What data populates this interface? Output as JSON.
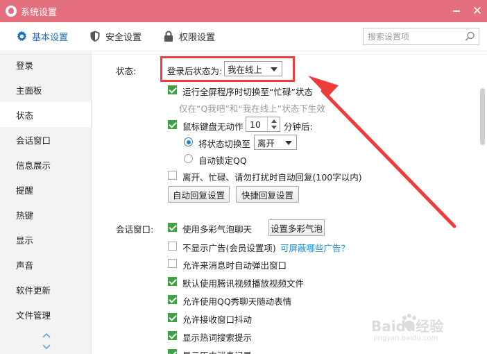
{
  "window": {
    "title": "系统设置"
  },
  "toolbar": {
    "tabs": [
      {
        "label": "基本设置",
        "icon": "gear-icon",
        "active": true
      },
      {
        "label": "安全设置",
        "icon": "shield-icon",
        "active": false
      },
      {
        "label": "权限设置",
        "icon": "lock-icon",
        "active": false
      }
    ],
    "search_placeholder": "搜索设置项"
  },
  "sidebar": {
    "items": [
      {
        "label": "登录"
      },
      {
        "label": "主面板"
      },
      {
        "label": "状态",
        "active": true
      },
      {
        "label": "会话窗口"
      },
      {
        "label": "信息展示"
      },
      {
        "label": "提醒"
      },
      {
        "label": "热键"
      },
      {
        "label": "显示"
      },
      {
        "label": "声音"
      },
      {
        "label": "软件更新"
      },
      {
        "label": "文件管理"
      }
    ]
  },
  "status_section": {
    "heading": "状态:",
    "login_status_label": "登录后状态为:",
    "login_status_value": "我在线上",
    "fullscreen_busy": {
      "label": "运行全屏程序时切换至“忙碌”状态",
      "checked": true
    },
    "fullscreen_hint": "仅在“Q我吧”和“我在线上”状态下生效",
    "idle": {
      "label_prefix": "鼠标键盘无动作",
      "minutes": "10",
      "label_suffix": "分钟后:",
      "checked": true
    },
    "switch_status": {
      "label": "将状态切换至",
      "value": "离开",
      "selected": true
    },
    "auto_lock": {
      "label": "自动锁定QQ",
      "selected": false
    },
    "auto_reply": {
      "label": "离开、忙碌、请勿打扰时自动回复(100字以内)",
      "checked": false
    },
    "auto_reply_settings_button": "自动回复设置",
    "quick_reply_settings_button": "快捷回复设置"
  },
  "session_section": {
    "heading": "会话窗口:",
    "options": [
      {
        "label": "使用多彩气泡聊天",
        "checked": true
      },
      {
        "label": "不显示广告(会员设置项)",
        "checked": false
      },
      {
        "label": "允许来消息时自动弹出窗口",
        "checked": false
      },
      {
        "label": "默认使用腾讯视频播放视频文件",
        "checked": true
      },
      {
        "label": "允许使用QQ秀聊天随动表情",
        "checked": true
      },
      {
        "label": "允许接收窗口抖动",
        "checked": true
      },
      {
        "label": "显示热词搜索提示",
        "checked": true
      },
      {
        "label": "显示历史消息记录",
        "checked": true
      }
    ],
    "bubble_settings_button": "设置多彩气泡",
    "ad_link": "可屏蔽哪些广告？"
  },
  "watermark": {
    "brand": "Baidu经验",
    "url": "jingyan.baidu.com"
  },
  "colors": {
    "titlebar": "#e4707d",
    "accent": "#1f6fb8",
    "checkbox": "#3fa046",
    "annotation": "#ee3b3b",
    "link": "#1a8fd6"
  }
}
